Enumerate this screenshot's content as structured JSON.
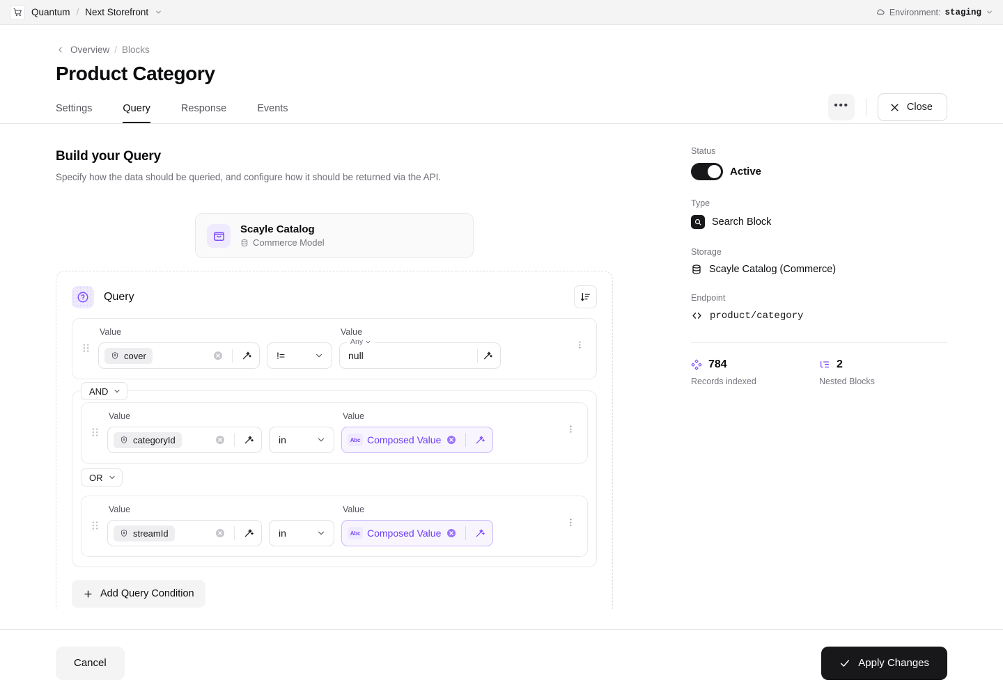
{
  "topbar": {
    "logo_icon": "shopping-cart-icon",
    "org": "Quantum",
    "separator": "/",
    "project": "Next Storefront",
    "project_chevron_icon": "chevron-down-icon",
    "env_icon": "cloud-icon",
    "env_label": "Environment:",
    "env_value": "staging",
    "env_chevron_icon": "chevron-down-icon"
  },
  "header": {
    "back_icon": "chevron-left-icon",
    "breadcrumb_parent": "Overview",
    "breadcrumb_sep": "/",
    "breadcrumb_current": "Blocks",
    "title": "Product Category",
    "more_label": "•••",
    "close_icon": "close-icon",
    "close_label": "Close"
  },
  "tabs": [
    {
      "label": "Settings",
      "active": false
    },
    {
      "label": "Query",
      "active": true
    },
    {
      "label": "Response",
      "active": false
    },
    {
      "label": "Events",
      "active": false
    }
  ],
  "main": {
    "title": "Build your Query",
    "subtitle": "Specify how the data should be queried, and configure how it should be returned via the API.",
    "source": {
      "icon": "shopping-bag-icon",
      "name": "Scayle Catalog",
      "meta_icon": "database-icon",
      "meta": "Commerce Model"
    },
    "query_card": {
      "icon": "question-mark-icon",
      "title": "Query",
      "sort_icon": "sort-descending-icon",
      "row1": {
        "grip_icon": "drag-handle-icon",
        "left_label": "Value",
        "left_chip_icon": "field-icon",
        "left_chip": "cover",
        "clear_icon": "clear-circle-icon",
        "wand_icon": "magic-wand-icon",
        "operator": "!=",
        "operator_chevron_icon": "chevron-down-icon",
        "right_label": "Value",
        "right_type": "Any",
        "right_type_chevron_icon": "chevron-down-icon",
        "right_value": "null",
        "right_wand_icon": "magic-wand-icon",
        "menu_icon": "more-vertical-icon"
      },
      "and_group": {
        "connector": "AND",
        "connector_chevron_icon": "chevron-down-icon",
        "row": {
          "grip_icon": "drag-handle-icon",
          "left_label": "Value",
          "left_chip_icon": "field-icon",
          "left_chip": "categoryId",
          "clear_icon": "clear-circle-icon",
          "wand_icon": "magic-wand-icon",
          "operator": "in",
          "operator_chevron_icon": "chevron-down-icon",
          "right_label": "Value",
          "right_badge": "Abc",
          "right_value": "Composed Value",
          "right_clear_icon": "clear-circle-icon",
          "right_wand_icon": "magic-wand-icon",
          "menu_icon": "more-vertical-icon"
        }
      },
      "or_group": {
        "connector": "OR",
        "connector_chevron_icon": "chevron-down-icon",
        "row": {
          "grip_icon": "drag-handle-icon",
          "left_label": "Value",
          "left_chip_icon": "field-icon",
          "left_chip": "streamId",
          "clear_icon": "clear-circle-icon",
          "wand_icon": "magic-wand-icon",
          "operator": "in",
          "operator_chevron_icon": "chevron-down-icon",
          "right_label": "Value",
          "right_badge": "Abc",
          "right_value": "Composed Value",
          "right_clear_icon": "clear-circle-icon",
          "right_wand_icon": "magic-wand-icon",
          "menu_icon": "more-vertical-icon"
        }
      },
      "add_condition_icon": "plus-icon",
      "add_condition_label": "Add Query Condition"
    }
  },
  "sidebar": {
    "status_label": "Status",
    "status_value": "Active",
    "type_label": "Type",
    "type_icon": "search-block-icon",
    "type_value": "Search Block",
    "storage_label": "Storage",
    "storage_icon": "database-icon",
    "storage_value": "Scayle Catalog (Commerce)",
    "endpoint_label": "Endpoint",
    "endpoint_icon": "code-brackets-icon",
    "endpoint_value": "product/category",
    "stats": [
      {
        "icon": "blocks-diamond-icon",
        "value": "784",
        "caption": "Records indexed"
      },
      {
        "icon": "nested-list-icon",
        "value": "2",
        "caption": "Nested Blocks"
      }
    ]
  },
  "footer": {
    "cancel_label": "Cancel",
    "apply_icon": "check-icon",
    "apply_label": "Apply Changes"
  },
  "colors": {
    "accent_purple": "#7c4dfd",
    "accent_purple_soft": "#efeafe",
    "ink": "#18181b",
    "muted": "#75757e",
    "border": "#e7e7ea"
  }
}
